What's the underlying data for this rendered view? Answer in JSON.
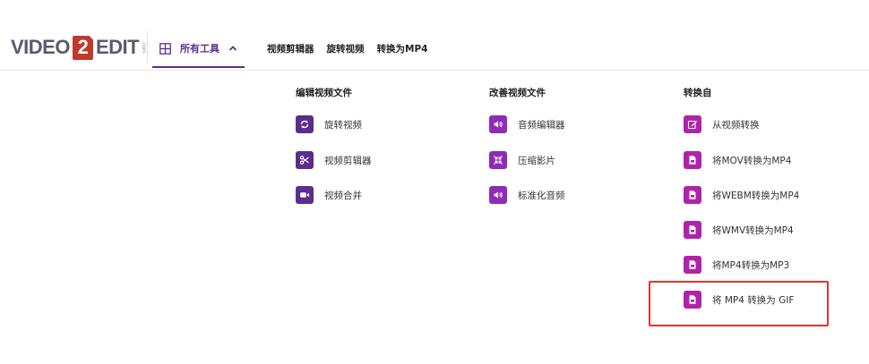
{
  "brand": {
    "part1": "VIDEO",
    "part2": "2",
    "part3": "EDIT",
    "tld": ".com"
  },
  "header": {
    "all_tools": "所有工具",
    "links": [
      "视频剪辑器",
      "旋转视频",
      "转换为MP4"
    ]
  },
  "colors": {
    "accent": "#5b2d8e",
    "improve": "#8e2bb8",
    "convert": "#b023a8",
    "highlight": "#e5322d"
  },
  "menu": {
    "edit": {
      "title": "编辑视频文件",
      "items": [
        {
          "label": "旋转视频",
          "icon": "rotate-icon"
        },
        {
          "label": "视频剪辑器",
          "icon": "scissors-icon"
        },
        {
          "label": "视频合并",
          "icon": "video-camera-icon"
        }
      ]
    },
    "improve": {
      "title": "改善视频文件",
      "items": [
        {
          "label": "音频编辑器",
          "icon": "speaker-icon"
        },
        {
          "label": "压缩影片",
          "icon": "compress-icon"
        },
        {
          "label": "标准化音频",
          "icon": "speaker-icon"
        }
      ]
    },
    "convert": {
      "title": "转换自",
      "items": [
        {
          "label": "从视频转换",
          "icon": "edit-icon"
        },
        {
          "label": "将MOV转换为MP4",
          "icon": "file-icon"
        },
        {
          "label": "将WEBM转换为MP4",
          "icon": "file-icon"
        },
        {
          "label": "将WMV转换为MP4",
          "icon": "file-icon"
        },
        {
          "label": "将MP4转换为MP3",
          "icon": "file-icon"
        },
        {
          "label": "将 MP4 转换为 GIF",
          "icon": "file-icon"
        }
      ]
    }
  }
}
